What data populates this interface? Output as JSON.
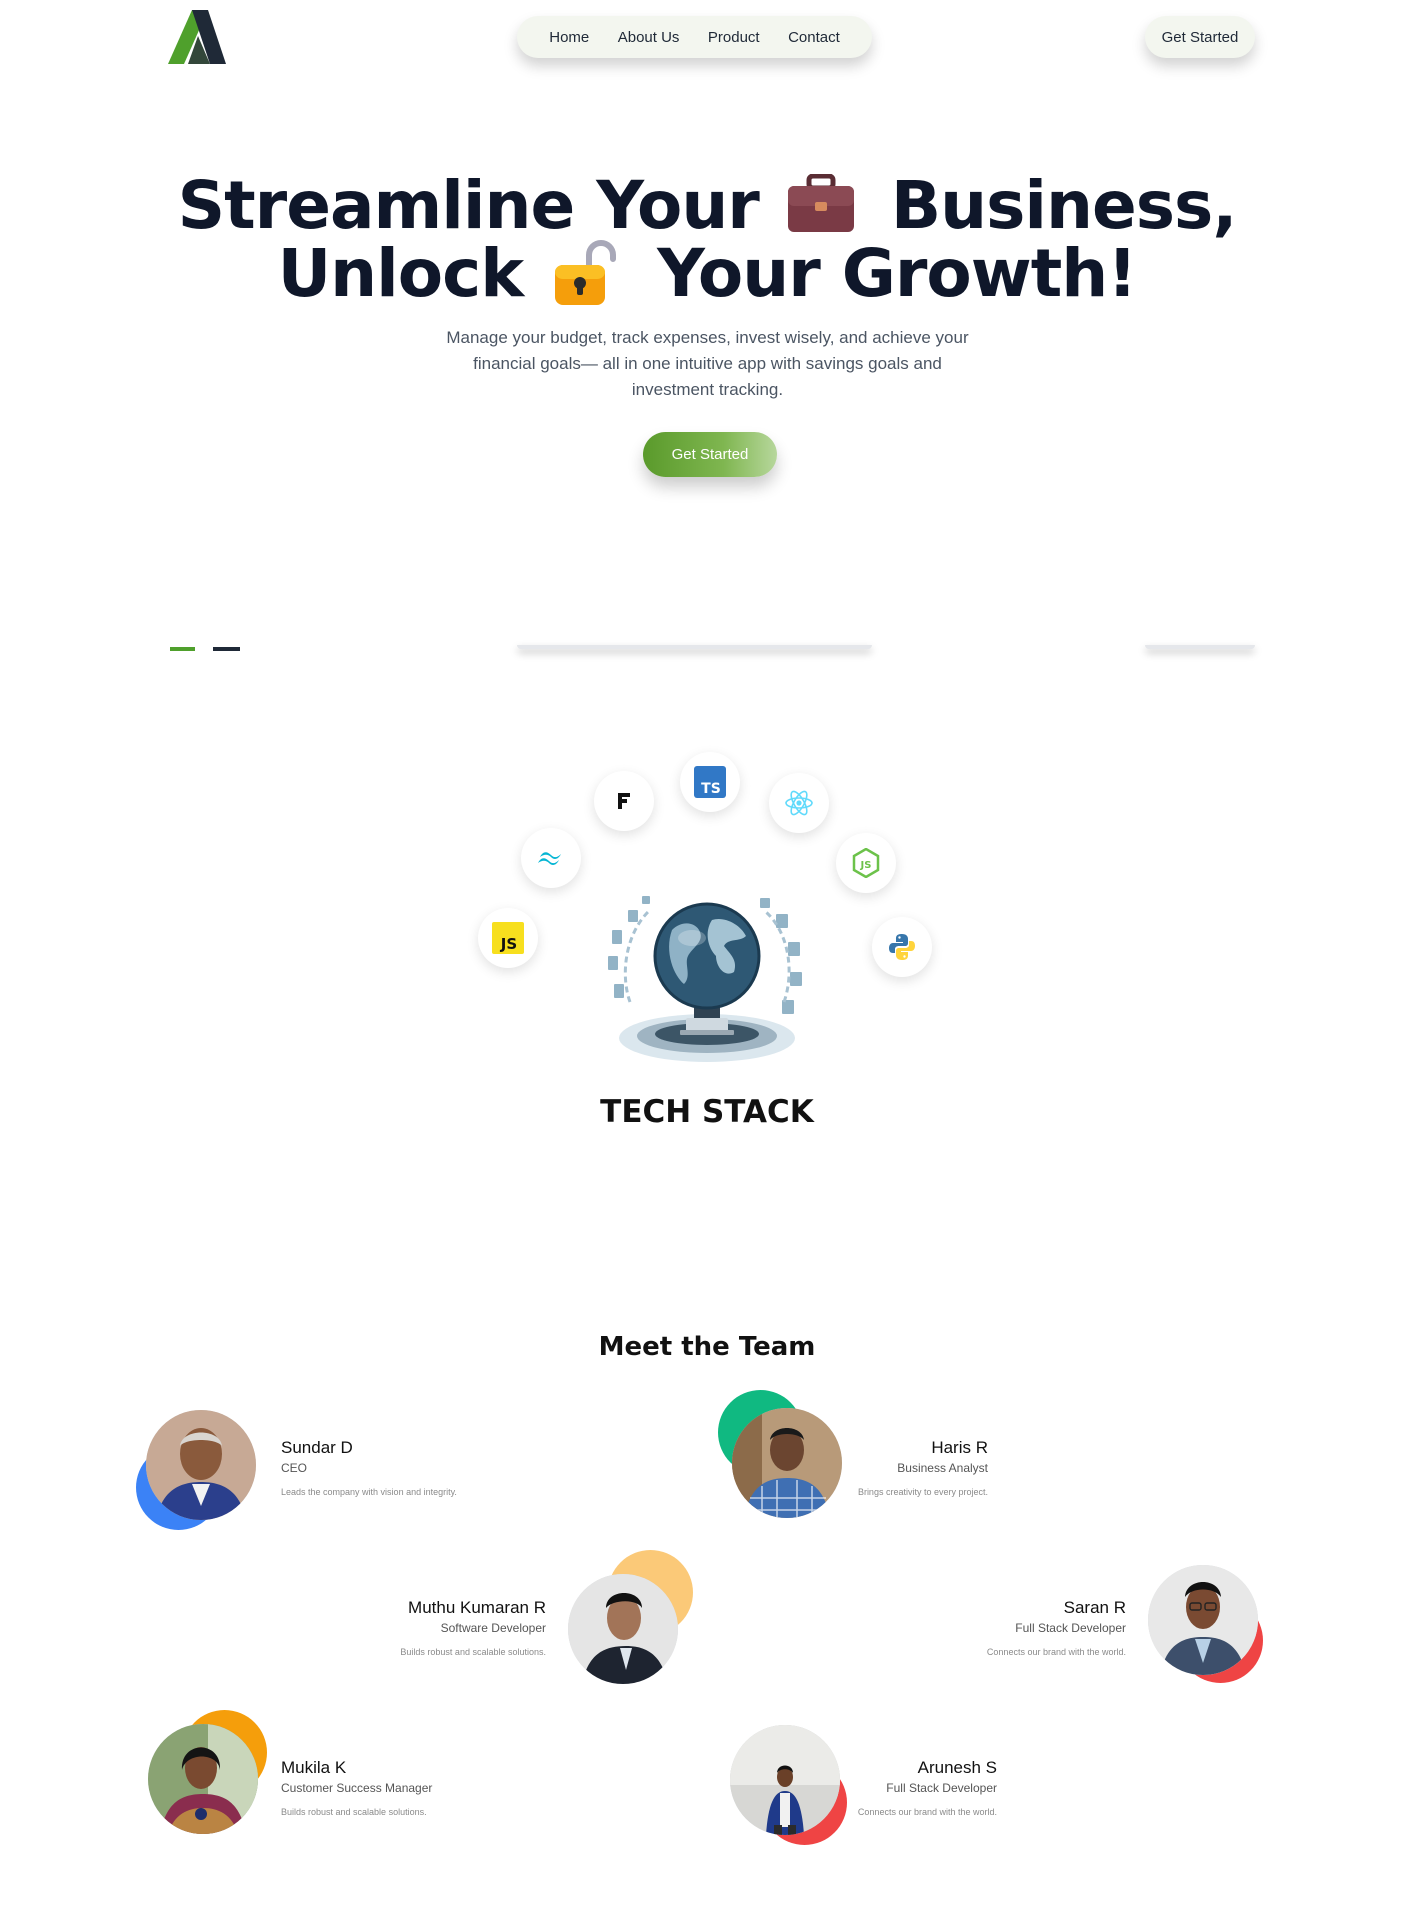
{
  "nav": {
    "items": [
      "Home",
      "About Us",
      "Product",
      "Contact"
    ],
    "cta": "Get Started"
  },
  "hero": {
    "line1_a": "Streamline Your",
    "line1_b": "Business,",
    "line2_a": "Unlock",
    "line2_b": "Your Growth!",
    "subtitle": "Manage your budget, track expenses, invest wisely, and achieve your financial goals— all in one intuitive app with savings goals and investment tracking.",
    "cta": "Get Started",
    "icons": [
      "briefcase-icon",
      "unlocked-padlock-icon"
    ]
  },
  "tech": {
    "title": "TECH STACK",
    "icons": [
      "javascript-icon",
      "tailwind-icon",
      "framer-icon",
      "typescript-icon",
      "react-icon",
      "nodejs-icon",
      "python-icon",
      "globe-tech-illustration"
    ]
  },
  "team": {
    "title": "Meet the Team",
    "members": [
      {
        "name": "Sundar D",
        "role": "CEO",
        "desc": "Leads the company with vision and integrity."
      },
      {
        "name": "Haris R",
        "role": "Business Analyst",
        "desc": "Brings creativity to every project."
      },
      {
        "name": "Muthu Kumaran R",
        "role": "Software Developer",
        "desc": "Builds robust and scalable solutions."
      },
      {
        "name": "Saran R",
        "role": "Full Stack Developer",
        "desc": "Connects our brand with the world."
      },
      {
        "name": "Mukila K",
        "role": "Customer Success Manager",
        "desc": "Builds robust and scalable solutions."
      },
      {
        "name": "Arunesh S",
        "role": "Full Stack Developer",
        "desc": "Connects our brand with the world."
      }
    ]
  },
  "colors": {
    "brand_green": "#5a9a2b",
    "dark_navy": "#0f172a",
    "nav_bg": "#f3f6ef",
    "accent_blue": "#3b82f6",
    "accent_green": "#10b981",
    "accent_orange": "#f59e0b",
    "accent_red": "#ef4444"
  }
}
